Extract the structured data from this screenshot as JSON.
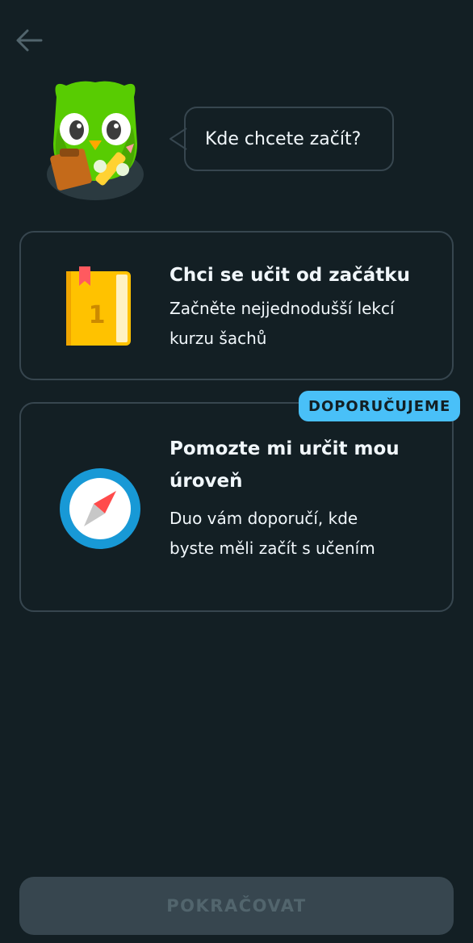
{
  "header": {
    "back_icon": "arrow-left-icon"
  },
  "prompt": {
    "text": "Kde chcete začít?"
  },
  "options": [
    {
      "icon": "book-icon",
      "icon_number": "1",
      "title": "Chci se učit od začátku",
      "description": "Začněte nejjednodušší lekcí kurzu šachů"
    },
    {
      "icon": "compass-icon",
      "badge": "DOPORUČUJEME",
      "title": "Pomozte mi určit mou úroveň",
      "description": "Duo vám doporučí, kde byste měli začít s učením"
    }
  ],
  "footer": {
    "continue_label": "POKRAČOVAT"
  },
  "colors": {
    "background": "#131f24",
    "border": "#37464f",
    "text": "#f1f7fb",
    "badge": "#49c0f8",
    "button_disabled_bg": "#37464f",
    "button_disabled_text": "#52656d",
    "mascot_green": "#58cc02",
    "book_yellow": "#ffc200",
    "compass_blue": "#1899d6"
  }
}
